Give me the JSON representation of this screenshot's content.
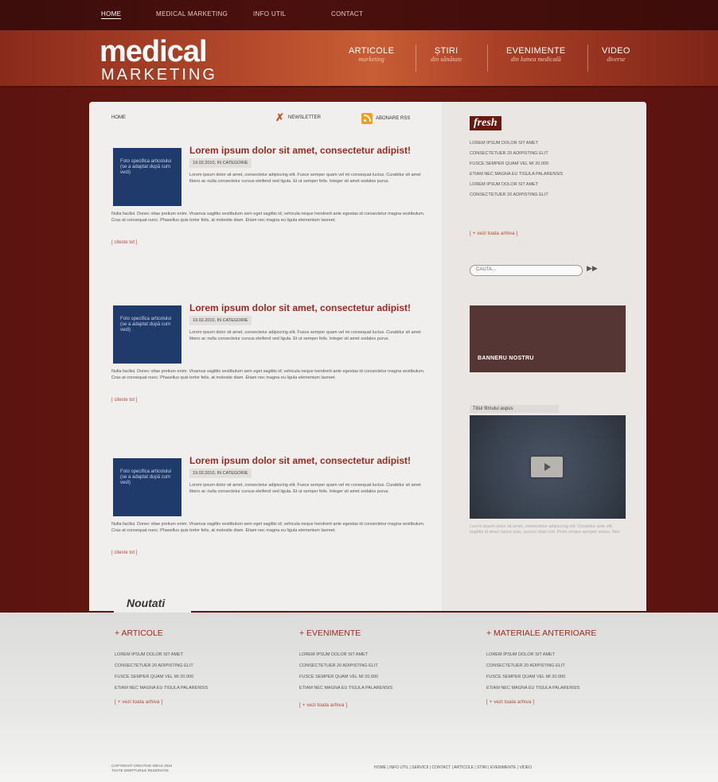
{
  "top_nav": [
    "Home",
    "Medical Marketing",
    "Info Util",
    "Contact"
  ],
  "logo": {
    "line1": "medical",
    "line2": "MARKETING"
  },
  "main_nav": [
    {
      "title": "ARTICOLE",
      "sub": "marketing"
    },
    {
      "title": "ȘTIRI",
      "sub": "din sănătate"
    },
    {
      "title": "EVENIMENTE",
      "sub": "din lumea medicală"
    },
    {
      "title": "VIDEO",
      "sub": "diverse"
    }
  ],
  "breadcrumb": "HOME",
  "tools": {
    "newsletter": "NEWSLETTER",
    "rss": "ABONARE RSS"
  },
  "articles": [
    {
      "thumb": "Foto specifica articolului (se a adaptat după cum vedi)",
      "title": "Lorem ipsum dolor sit amet, consectetur adipist!",
      "meta": "19.02.2010, IN CATEGORIE",
      "short": "Lorem ipsum dolor sit amet, consectetur adipiscing elit. Fusce semper quam vel mi consequat luctus. Curabitur sit amet libero ac nulla consectetur cursus eleifend sed ligula. Et ut semper felis. Integer sit amet sodales purus.",
      "long": "Nulla facilisi. Donec vitae pretium enim. Vivamus sagittis vestibulum sem eget sagittis id; vehicula neque hendrerit ante egestas id consectetur magna vestibulum. Cras at consequat nunc. Phasellus quis tortor felis, at molestie diam. Etiam nec magna eu ligula elementum laoreet.",
      "more": "[ citeste tot ]"
    },
    {
      "thumb": "Foto specifica articolului (se a adaptat după cum vedi)",
      "title": "Lorem ipsum dolor sit amet, consectetur adipist!",
      "meta": "19.02.2010, IN CATEGORIE",
      "short": "Lorem ipsum dolor sit amet, consectetur adipiscing elit. Fusce semper quam vel mi consequat luctus. Curabitur sit amet libero ac nulla consectetur cursus eleifend sed ligula. Et ut semper felis. Integer sit amet sodales purus.",
      "long": "Nulla facilisi. Donec vitae pretium enim. Vivamus sagittis vestibulum sem eget sagittis id; vehicula neque hendrerit ante egestas id consectetur magna vestibulum. Cras at consequat nunc. Phasellus quis tortor felis, at molestie diam. Etiam nec magna eu ligula elementum laoreet.",
      "more": "[ citeste tot ]"
    },
    {
      "thumb": "Foto specifica articolului (se a adaptat după cum vedi)",
      "title": "Lorem ipsum dolor sit amet, consectetur adipist!",
      "meta": "19.02.2010, IN CATEGORIE",
      "short": "Lorem ipsum dolor sit amet, consectetur adipiscing elit. Fusce semper quam vel mi consequat luctus. Curabitur sit amet libero ac nulla consectetur cursus eleifend sed ligula. Et ut semper felis. Integer sit amet sodales purus.",
      "long": "Nulla facilisi. Donec vitae pretium enim. Vivamus sagittis vestibulum sem eget sagittis id; vehicula neque hendrerit ante egestas id consectetur magna vestibulum. Cras at consequat nunc. Phasellus quis tortor felis, at molestie diam. Etiam nec magna eu ligula elementum laoreet.",
      "more": "[ citeste tot ]"
    }
  ],
  "sidebar": {
    "badge": "fresh",
    "items": [
      "LOREM IPSUM DOLOR SIT AMET",
      "CONSECTETUER 20 ADIPISTING ELIT",
      "FUSCE SEMPER QUAM VEL MI 20.000",
      "ETIAM NEC MAGNA EU TIGULA PALARENSIS",
      "LOREM IPSUM DOLOR SIT AMET",
      "CONSECTETUER 20 ADIPISTING ELIT"
    ],
    "more": "[ + vezi toata arhiva ]",
    "search_placeholder": "CAUTA...",
    "search_button": "▶▶",
    "banner": "BANNERU NOSTRU",
    "video_title": "Titlul filmului aspus",
    "video_caption": "Lorem ipsum dolor sit amet, consectetur adipiscing elit. Curabitur ante elit, sagittis id amet varius quis, cursus vitae nisl. Proin ornare semper varius. Nec"
  },
  "noutati": "Noutati",
  "footer": {
    "columns": [
      {
        "title": "+ ARTICOLE",
        "items": [
          "LOREM IPSUM DOLOR SIT AMET",
          "CONSECTETUER 20 ADIPISTING ELIT",
          "FUSCE SEMPER QUAM VEL MI 20.000",
          "ETIAM NEC MAGNA EU TIGULA PALARENSIS"
        ],
        "more": "[ + vezi toata arhiva ]"
      },
      {
        "title": "+ EVENIMENTE",
        "items": [
          "LOREM IPSUM DOLOR SIT AMET",
          "CONSECTETUER 20 ADIPISTING ELIT",
          "FUSCE SEMPER QUAM VEL MI 20.000",
          "ETIAM NEC MAGNA EU TIGULA PALARENSIS"
        ],
        "more": "[ + vezi toata arhiva ]"
      },
      {
        "title": "+ MATERIALE ANTERIOARE",
        "items": [
          "LOREM IPSUM DOLOR SIT AMET",
          "CONSECTETUER 20 ADIPISTING ELIT",
          "FUSCE SEMPER QUAM VEL MI 20.000",
          "ETIAM NEC MAGNA EU TIGULA PALARENSIS"
        ],
        "more": "[ + vezi toata arhiva ]"
      }
    ],
    "copyright": "COPYRIGHT CREATIVE IDEAS 2010",
    "rights": "TOATE DREPTURILE REZERVATE",
    "links": "HOME | INFO UTIL | SERVICII | CONTACT | ARTICOLE | STIRI | EVENIMENTE | VIDEO"
  }
}
